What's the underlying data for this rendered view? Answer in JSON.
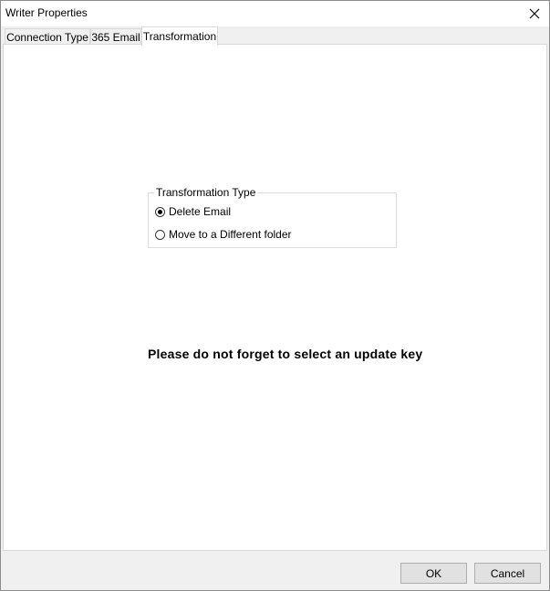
{
  "window": {
    "title": "Writer Properties"
  },
  "tabs": [
    {
      "label": "Connection Type"
    },
    {
      "label": "365 Email"
    },
    {
      "label": "Transformation"
    }
  ],
  "active_tab": "Transformation",
  "transformation": {
    "group_label": "Transformation Type",
    "options": [
      {
        "label": "Delete Email",
        "checked": true
      },
      {
        "label": "Move to a Different folder",
        "checked": false
      }
    ],
    "notice": "Please do not forget to select an update key"
  },
  "buttons": {
    "ok": "OK",
    "cancel": "Cancel"
  },
  "icons": {
    "close": "close-icon"
  }
}
